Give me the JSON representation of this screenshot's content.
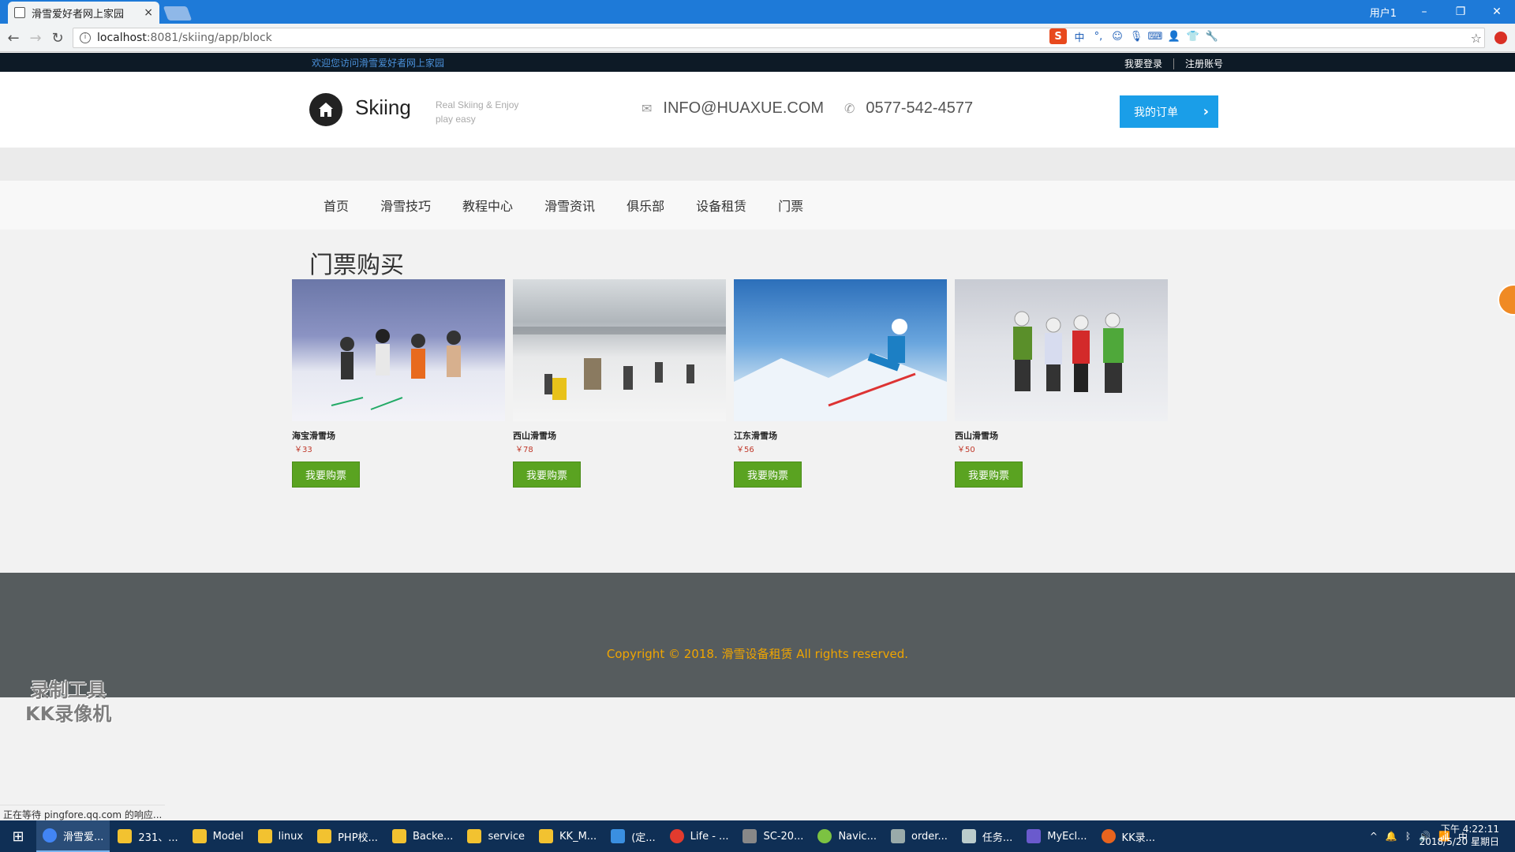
{
  "browser": {
    "tab_title": "滑雪爱好者网上家园",
    "tab_close": "×",
    "profile": "用户1",
    "window_controls": [
      "–",
      "❐",
      "✕"
    ],
    "url_host": "localhost",
    "url_path": ":8081/skiing/app/block",
    "status_text": "正在等待 pingfore.qq.com 的响应..."
  },
  "topbar": {
    "welcome": "欢迎您访问滑雪爱好者网上家园",
    "login": "我要登录",
    "register": "注册账号"
  },
  "header": {
    "logo_text": "Skiing",
    "tagline_1": "Real Skiing & Enjoy",
    "tagline_2": "play easy",
    "email": "INFO@HUAXUE.COM",
    "phone": "0577-542-4577",
    "order_button": "我的订单",
    "order_arrow": "›"
  },
  "nav": {
    "items": [
      "首页",
      "滑雪技巧",
      "教程中心",
      "滑雪资讯",
      "俱乐部",
      "设备租赁",
      "门票"
    ]
  },
  "section": {
    "title": "门票购买",
    "buy_label": "我要购票",
    "cards": [
      {
        "name": "海宝滑雪场",
        "price": "￥33"
      },
      {
        "name": "西山滑雪场",
        "price": "￥78"
      },
      {
        "name": "江东滑雪场",
        "price": "￥56"
      },
      {
        "name": "西山滑雪场",
        "price": "￥50"
      }
    ]
  },
  "footer": {
    "copyright": "Copyright © 2018. 滑雪设备租赁 All rights reserved."
  },
  "watermark": {
    "line1": "录制工具",
    "line2": "KK录像机"
  },
  "taskbar": {
    "items": [
      "滑雪爱...",
      "231、...",
      "Model",
      "linux",
      "PHP校...",
      "Backe...",
      "service",
      "KK_M...",
      "(定...",
      "Life - ...",
      "SC-20...",
      "Navic...",
      "order...",
      "任务...",
      "MyEcl...",
      "KK录..."
    ],
    "time": "下午 4:22:11",
    "date": "2018/5/20 星期日",
    "ime": "中"
  }
}
